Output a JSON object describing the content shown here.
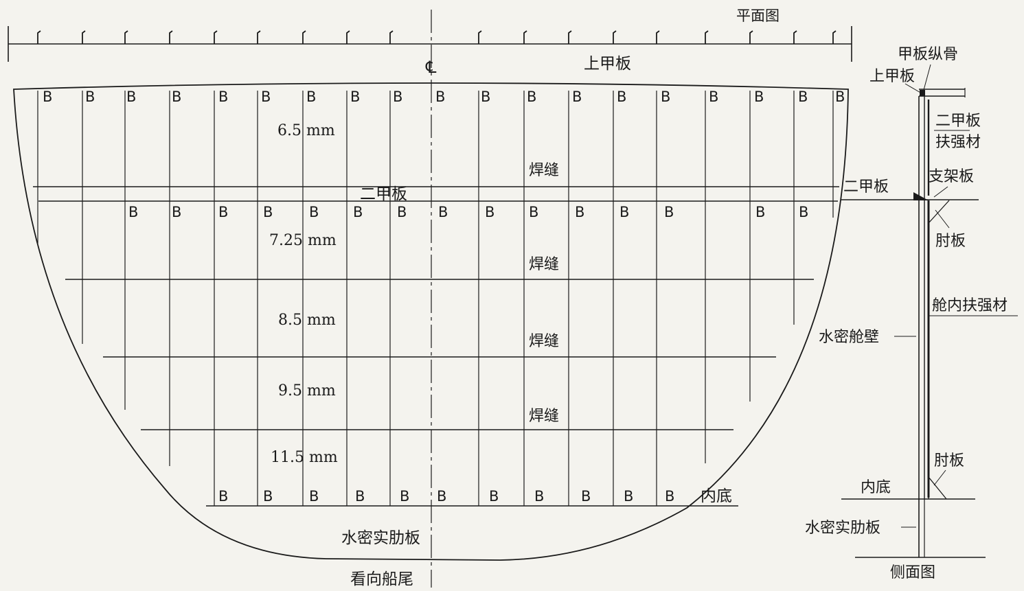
{
  "labels": {
    "plan_view": "平面图",
    "upper_deck_top": "上甲板",
    "centerline": "℄",
    "second_deck": "二甲板",
    "weld_1": "焊缝",
    "weld_2": "焊缝",
    "weld_3": "焊缝",
    "weld_4": "焊缝",
    "inner_bottom": "内底",
    "watertight_floor": "水密实肋板",
    "view_aft": "看向船尾",
    "thickness_1": "6.5 mm",
    "thickness_2": "7.25 mm",
    "thickness_3": "8.5 mm",
    "thickness_4": "9.5 mm",
    "thickness_5": "11.5 mm",
    "bracket_mark": "B"
  },
  "side_view": {
    "deck_longitudinal": "甲板纵骨",
    "upper_deck": "上甲板",
    "second_deck_stiffener_line1": "二甲板",
    "second_deck_stiffener_line2": "扶强材",
    "support_plate": "支架板",
    "second_deck": "二甲板",
    "bracket_upper": "肘板",
    "bulkhead_stiffener": "舱内扶强材",
    "watertight_bulkhead": "水密舱壁",
    "bracket_lower": "肘板",
    "inner_bottom": "内底",
    "watertight_floor": "水密实肋板",
    "side_view_title": "侧面图"
  }
}
